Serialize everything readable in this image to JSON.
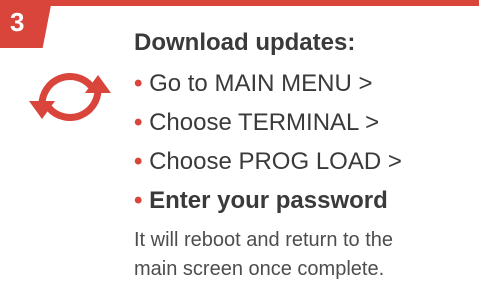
{
  "colors": {
    "accent": "#d9443b",
    "text": "#3a3a3a",
    "muted": "#4d4d4d"
  },
  "step": {
    "number": "3",
    "icon": "sync-arrows-icon"
  },
  "heading": "Download updates:",
  "bullet_symbol": "•",
  "steps": [
    {
      "text": "Go to MAIN MENU >"
    },
    {
      "text": "Choose TERMINAL >"
    },
    {
      "text": "Choose PROG LOAD >"
    },
    {
      "text": "Enter your password"
    }
  ],
  "note": {
    "line1": "It will reboot and return to the",
    "line2": "main screen once complete."
  }
}
